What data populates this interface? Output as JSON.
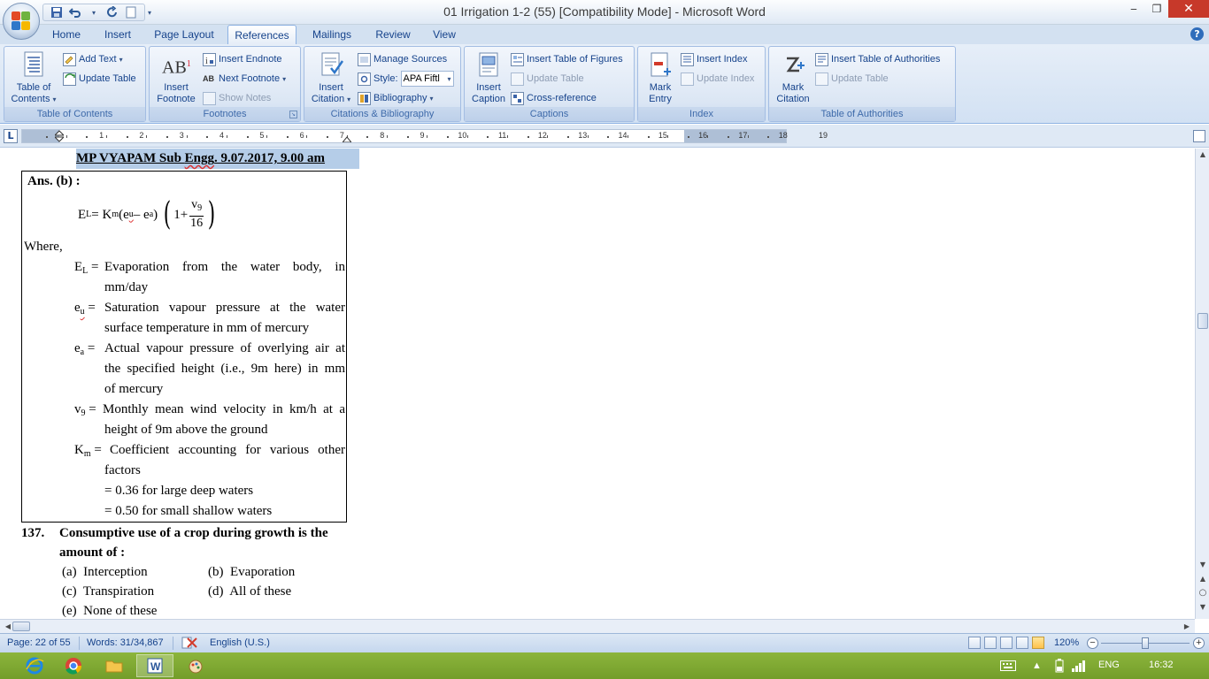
{
  "window": {
    "title": "01 Irrigation 1-2 (55) [Compatibility Mode] - Microsoft Word",
    "minimize": "‒",
    "restore": "❐",
    "close": "✕"
  },
  "qat": {
    "save": "💾",
    "undo": "↶",
    "dropdown": "▾",
    "redo": "↻",
    "customize": "▾"
  },
  "tabs": [
    {
      "label": "Home"
    },
    {
      "label": "Insert"
    },
    {
      "label": "Page Layout"
    },
    {
      "label": "References"
    },
    {
      "label": "Mailings"
    },
    {
      "label": "Review"
    },
    {
      "label": "View"
    }
  ],
  "help": "?",
  "ribbon": {
    "toc_group": {
      "label": "Table of Contents",
      "table_of_contents": "Table of",
      "table_of_contents_2": "Contents",
      "add_text": "Add Text",
      "update_table": "Update Table"
    },
    "footnotes_group": {
      "label": "Footnotes",
      "insert_footnote": "Insert",
      "insert_footnote_2": "Footnote",
      "insert_endnote": "Insert Endnote",
      "next_footnote": "Next Footnote",
      "show_notes": "Show Notes",
      "icon_text": "AB",
      "icon_sup": "1",
      "next_icon": "AB"
    },
    "citations_group": {
      "label": "Citations & Bibliography",
      "insert_citation": "Insert",
      "insert_citation_2": "Citation",
      "manage_sources": "Manage Sources",
      "style_label": "Style:",
      "style_value": "APA Fiftl",
      "bibliography": "Bibliography"
    },
    "captions_group": {
      "label": "Captions",
      "insert_caption": "Insert",
      "insert_caption_2": "Caption",
      "insert_table_of_figures": "Insert Table of Figures",
      "update_table": "Update Table",
      "cross_reference": "Cross-reference"
    },
    "index_group": {
      "label": "Index",
      "mark_entry": "Mark",
      "mark_entry_2": "Entry",
      "insert_index": "Insert Index",
      "update_index": "Update Index"
    },
    "toa_group": {
      "label": "Table of Authorities",
      "mark_citation": "Mark",
      "mark_citation_2": "Citation",
      "insert_toa": "Insert Table of Authorities",
      "update_table": "Update Table"
    }
  },
  "ruler": {
    "tab_selector": "L",
    "numbers": [
      "1",
      "2",
      "3",
      "4",
      "5",
      "6",
      "7",
      "8",
      "9",
      "10",
      "11",
      "12",
      "13",
      "14",
      "15",
      "16",
      "17",
      "18",
      "19"
    ]
  },
  "document": {
    "heading": "MP VYAPAM Sub Engg. 9.07.2017, 9.00 am",
    "heading_pre": "MP VYAPAM Sub ",
    "heading_engg": "Engg",
    "heading_post": ". 9.07.2017, 9.00 am",
    "answer_label": "Ans. (b) :",
    "formula": {
      "lhs": "E",
      "lhs_sub": "L",
      "eq": " = K",
      "k_sub": "m",
      "paren_open": " (e",
      "e1_sub": "u",
      "minus": " – e",
      "e2_sub": "a",
      "paren_close": ")",
      "one_plus": "1+",
      "frac_num": "v",
      "frac_num_sub": "9",
      "frac_den": "16"
    },
    "where": "Where,",
    "definitions": [
      {
        "sym": "E",
        "sub": "L",
        "eq": " =",
        "lines": [
          "Evaporation from the water body, in",
          "mm/day"
        ]
      },
      {
        "sym": "e",
        "sub": "u",
        "eq": " =",
        "lines": [
          "Saturation vapour pressure at the water",
          "surface temperature in mm of mercury"
        ]
      },
      {
        "sym": "e",
        "sub": "a",
        "eq": " =",
        "lines": [
          "Actual vapour pressure of overlying air at",
          "the specified height (i.e., 9m here) in mm",
          "of mercury"
        ]
      },
      {
        "sym": "v",
        "sub": "9",
        "eq": " =",
        "lines": [
          "Monthly mean wind velocity in km/h at a",
          "height of 9m above the ground"
        ]
      },
      {
        "sym": "K",
        "sub": "m",
        "eq": " =",
        "lines": [
          "Coefficient accounting for various other",
          "factors",
          "= 0.36 for large deep waters",
          "= 0.50 for small shallow waters"
        ]
      }
    ],
    "question": {
      "number": "137.",
      "text_line1": "Consumptive use of a crop during growth is the",
      "text_line2": "amount of :",
      "options": [
        {
          "key": "(a)",
          "text": "Interception"
        },
        {
          "key": "(b)",
          "text": "Evaporation"
        },
        {
          "key": "(c)",
          "text": "Transpiration"
        },
        {
          "key": "(d)",
          "text": "All of these"
        },
        {
          "key": "(e)",
          "text": "None of these"
        }
      ]
    }
  },
  "statusbar": {
    "page": "Page: 22 of 55",
    "words": "Words: 31/34,867",
    "language": "English (U.S.)",
    "zoom": "120%",
    "zoom_minus": "−",
    "zoom_plus": "+"
  },
  "taskbar": {
    "language": "ENG",
    "time": "16:32"
  },
  "colors": {
    "accent": "#15428b",
    "highlight": "#b5cde8",
    "close": "#c7392a",
    "taskbar": "#7ca432"
  }
}
